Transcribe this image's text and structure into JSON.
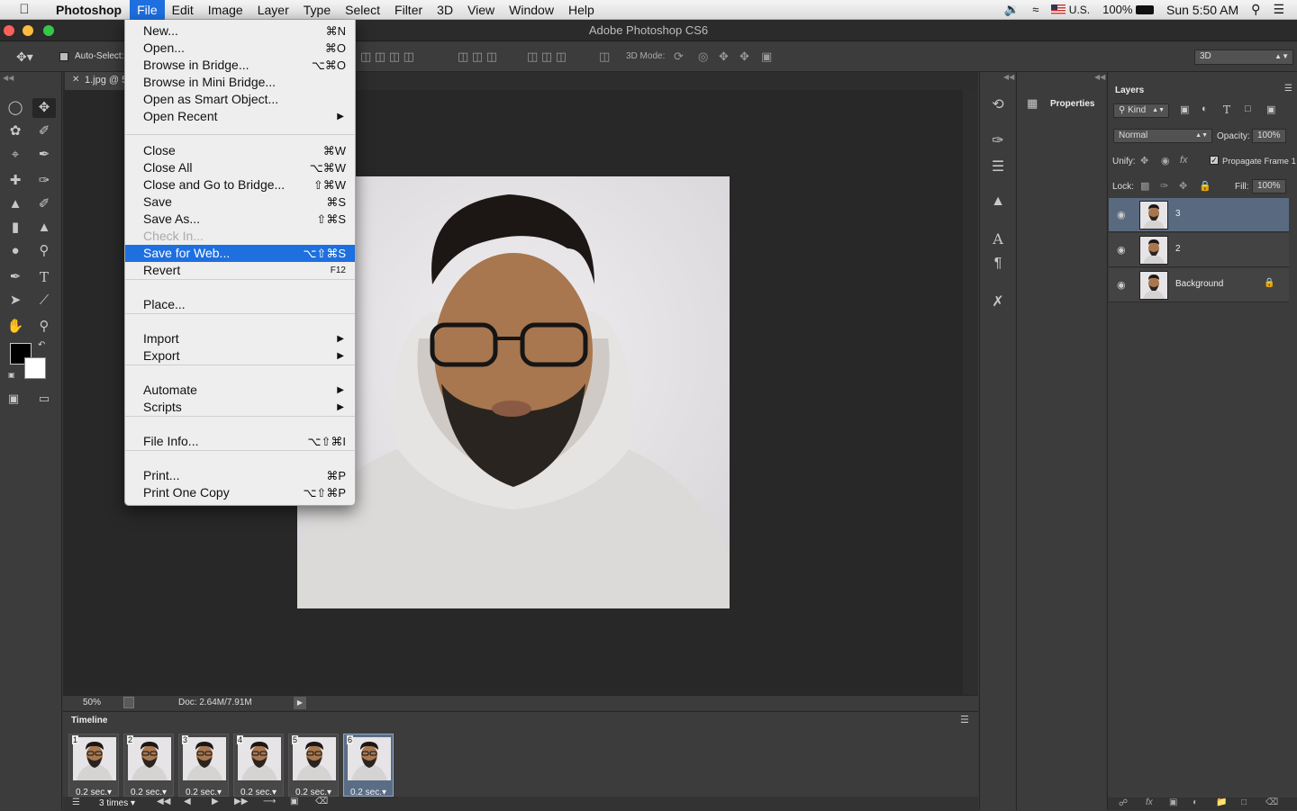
{
  "menubar": {
    "app_name": "Photoshop",
    "items": [
      "File",
      "Edit",
      "Image",
      "Layer",
      "Type",
      "Select",
      "Filter",
      "3D",
      "View",
      "Window",
      "Help"
    ],
    "status": {
      "input_source": "U.S.",
      "battery": "100%",
      "clock": "Sun 5:50 AM"
    }
  },
  "window": {
    "title": "Adobe Photoshop CS6"
  },
  "options_bar": {
    "auto_select_label": "Auto-Select:",
    "mode_label": "3D Mode:",
    "workspace": "3D"
  },
  "document": {
    "tab_label": "1.jpg @ 5",
    "zoom": "50%",
    "doc_info": "Doc: 2.64M/7.91M"
  },
  "file_menu": {
    "items": [
      {
        "label": "New...",
        "shortcut": "⌘N"
      },
      {
        "label": "Open...",
        "shortcut": "⌘O"
      },
      {
        "label": "Browse in Bridge...",
        "shortcut": "⌥⌘O"
      },
      {
        "label": "Browse in Mini Bridge...",
        "shortcut": ""
      },
      {
        "label": "Open as Smart Object...",
        "shortcut": ""
      },
      {
        "label": "Open Recent",
        "shortcut": ""
      },
      {
        "label": "Close",
        "shortcut": "⌘W"
      },
      {
        "label": "Close All",
        "shortcut": "⌥⌘W"
      },
      {
        "label": "Close and Go to Bridge...",
        "shortcut": "⇧⌘W"
      },
      {
        "label": "Save",
        "shortcut": "⌘S"
      },
      {
        "label": "Save As...",
        "shortcut": "⇧⌘S"
      },
      {
        "label": "Check In...",
        "shortcut": ""
      },
      {
        "label": "Save for Web...",
        "shortcut": "⌥⇧⌘S"
      },
      {
        "label": "Revert",
        "shortcut": "F12"
      },
      {
        "label": "Place...",
        "shortcut": ""
      },
      {
        "label": "Import",
        "shortcut": ""
      },
      {
        "label": "Export",
        "shortcut": ""
      },
      {
        "label": "Automate",
        "shortcut": ""
      },
      {
        "label": "Scripts",
        "shortcut": ""
      },
      {
        "label": "File Info...",
        "shortcut": "⌥⇧⌘I"
      },
      {
        "label": "Print...",
        "shortcut": "⌘P"
      },
      {
        "label": "Print One Copy",
        "shortcut": "⌥⇧⌘P"
      }
    ],
    "highlighted": "Save for Web...",
    "disabled": [
      "Check In..."
    ],
    "submenus": [
      "Open Recent",
      "Import",
      "Export",
      "Automate",
      "Scripts"
    ]
  },
  "timeline": {
    "title": "Timeline",
    "frames": [
      {
        "num": "1",
        "delay": "0.2 sec."
      },
      {
        "num": "2",
        "delay": "0.2 sec."
      },
      {
        "num": "3",
        "delay": "0.2 sec."
      },
      {
        "num": "4",
        "delay": "0.2 sec."
      },
      {
        "num": "5",
        "delay": "0.2 sec."
      },
      {
        "num": "6",
        "delay": "0.2 sec."
      }
    ],
    "selected_frame": "6",
    "loop": "3 times"
  },
  "properties_panel": {
    "title": "Properties"
  },
  "layers_panel": {
    "title": "Layers",
    "kind": "Kind",
    "blend_mode": "Normal",
    "opacity_label": "Opacity:",
    "opacity": "100%",
    "unify_label": "Unify:",
    "propagate_label": "Propagate Frame 1",
    "lock_label": "Lock:",
    "fill_label": "Fill:",
    "fill": "100%",
    "layers": [
      {
        "name": "3",
        "selected": true
      },
      {
        "name": "2",
        "selected": false
      },
      {
        "name": "Background",
        "selected": false,
        "locked": true
      }
    ]
  },
  "colors": {
    "accent": "#1e6fe0",
    "panel": "#3c3c3c",
    "canvas": "#282828",
    "selection": "#596a80"
  }
}
